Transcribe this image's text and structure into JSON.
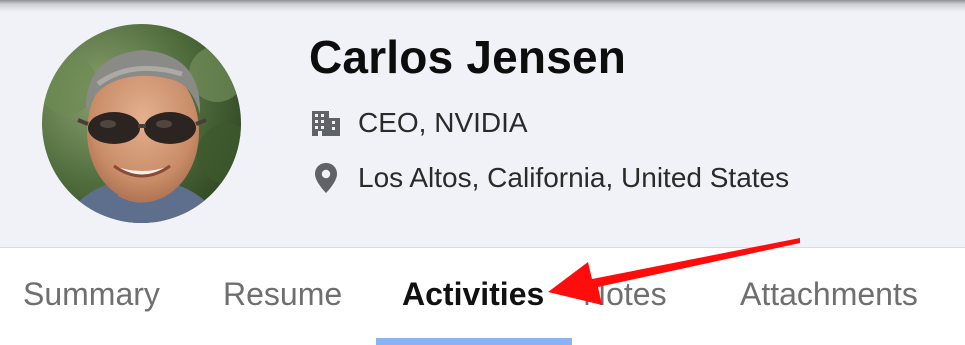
{
  "profile": {
    "name": "Carlos Jensen",
    "title": "CEO, NVIDIA",
    "location": "Los Altos, California, United States",
    "avatar_icon": "profile-photo"
  },
  "icons": {
    "title_icon": "building-icon",
    "location_icon": "map-pin-icon"
  },
  "tabs": [
    {
      "label": "Summary",
      "active": false
    },
    {
      "label": "Resume",
      "active": false
    },
    {
      "label": "Activities",
      "active": true
    },
    {
      "label": "Notes",
      "active": false
    },
    {
      "label": "Attachments",
      "active": false
    }
  ],
  "colors": {
    "header_bg": "#f1f2f7",
    "active_underline": "#8ab3f3",
    "annotation_arrow": "#ff0d0d"
  }
}
